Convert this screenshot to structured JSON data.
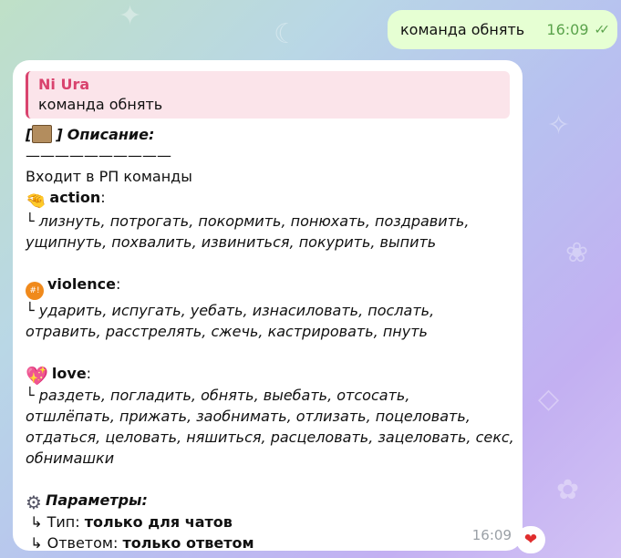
{
  "outgoing": {
    "text": "команда обнять",
    "time": "16:09",
    "status_icon": "double-check-icon"
  },
  "incoming": {
    "reply": {
      "author": "Ni Ura",
      "text": "команда обнять"
    },
    "header": {
      "open": "[",
      "close": "]",
      "title": "Описание:"
    },
    "separator": "——————————",
    "intro": "Входит в РП команды",
    "action": {
      "name": "action",
      "colon": ":",
      "line1": "лизнуть, потрогать, покормить, понюхать, поздравить,",
      "line2": "ущипнуть, похвалить, извиниться, покурить, выпить"
    },
    "violence": {
      "name": "violence",
      "colon": ":",
      "line1": "ударить, испугать, уебать, изнасиловать, послать,",
      "line2": "отравить, расстрелять, сжечь, кастрировать, пнуть"
    },
    "love": {
      "name": "love",
      "colon": ":",
      "line1": "раздеть, погладить, обнять, выебать, отсосать,",
      "line2": "отшлёпать, прижать, заобнимать, отлизать, поцеловать,",
      "line3": "отдаться, целовать, няшиться, расцеловать, зацеловать, секс,",
      "line4": "обнимашки"
    },
    "params": {
      "title": "Параметры:",
      "type_label": "Тип: ",
      "type_value": "только для чатов",
      "answer_label": "Ответом: ",
      "answer_value": "только ответом"
    },
    "prefix": "└",
    "arrow": "↳",
    "time": "16:09",
    "reaction": "heart-reaction"
  },
  "colors": {
    "outgoing_bubble": "#e6ffd3",
    "incoming_bubble": "#ffffff",
    "reply_accent": "#d9436e",
    "reply_background": "#fbe4ea",
    "check": "#5aa34b"
  }
}
